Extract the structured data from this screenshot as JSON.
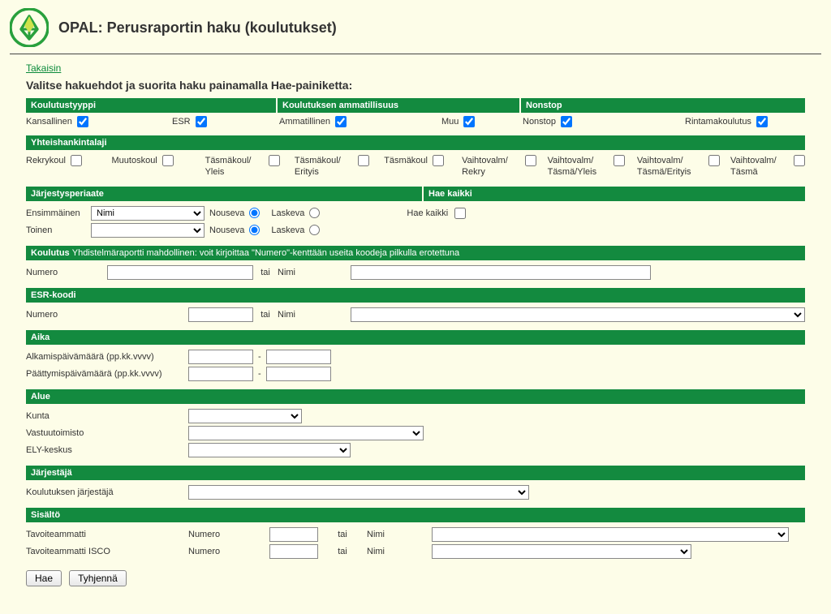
{
  "header": {
    "title": "OPAL: Perusraportin haku (koulutukset)"
  },
  "backlink": "Takaisin",
  "instruction": "Valitse hakuehdot ja suorita haku painamalla Hae-painiketta:",
  "section1": {
    "col1": "Koulutustyyppi",
    "col2": "Koulutuksen ammatillisuus",
    "col3": "Nonstop",
    "kansallinen": "Kansallinen",
    "esr": "ESR",
    "ammatillinen": "Ammatillinen",
    "muu": "Muu",
    "nonstop": "Nonstop",
    "rintama": "Rintamakoulutus"
  },
  "yhteis": {
    "title": "Yhteishankintalaji",
    "items": [
      "Rekrykoul",
      "Muutoskoul",
      "Täsmäkoul/ Yleis",
      "Täsmäkoul/ Erityis",
      "Täsmäkoul",
      "Vaihtovalm/ Rekry",
      "Vaihtovalm/ Täsmä/Yleis",
      "Vaihtovalm/ Täsmä/Erityis",
      "Vaihtovalm/ Täsmä"
    ]
  },
  "jarj": {
    "title": "Järjestysperiaate",
    "title2": "Hae kaikki",
    "ensimmainen": "Ensimmäinen",
    "toinen": "Toinen",
    "nouseva": "Nouseva",
    "laskeva": "Laskeva",
    "haekaikki": "Hae kaikki",
    "sel1": "Nimi",
    "sel2": ""
  },
  "koulutus": {
    "title": "Koulutus",
    "sub": "Yhdistelmäraportti mahdollinen: voit kirjoittaa \"Numero\"-kenttään useita koodeja pilkulla erotettuna",
    "numero": "Numero",
    "tai": "tai",
    "nimi": "Nimi"
  },
  "esrkoodi": {
    "title": "ESR-koodi",
    "numero": "Numero",
    "tai": "tai",
    "nimi": "Nimi"
  },
  "aika": {
    "title": "Aika",
    "alk": "Alkamispäivämäärä (pp.kk.vvvv)",
    "paat": "Päättymispäivämäärä (pp.kk.vvvv)",
    "sep": "-"
  },
  "alue": {
    "title": "Alue",
    "kunta": "Kunta",
    "vastuu": "Vastuutoimisto",
    "ely": "ELY-keskus"
  },
  "jarjestaja": {
    "title": "Järjestäjä",
    "label": "Koulutuksen järjestäjä"
  },
  "sisalto": {
    "title": "Sisältö",
    "tav": "Tavoiteammatti",
    "tavisco": "Tavoiteammatti ISCO",
    "numero": "Numero",
    "tai": "tai",
    "nimi": "Nimi"
  },
  "buttons": {
    "hae": "Hae",
    "tyhjenna": "Tyhjennä"
  }
}
